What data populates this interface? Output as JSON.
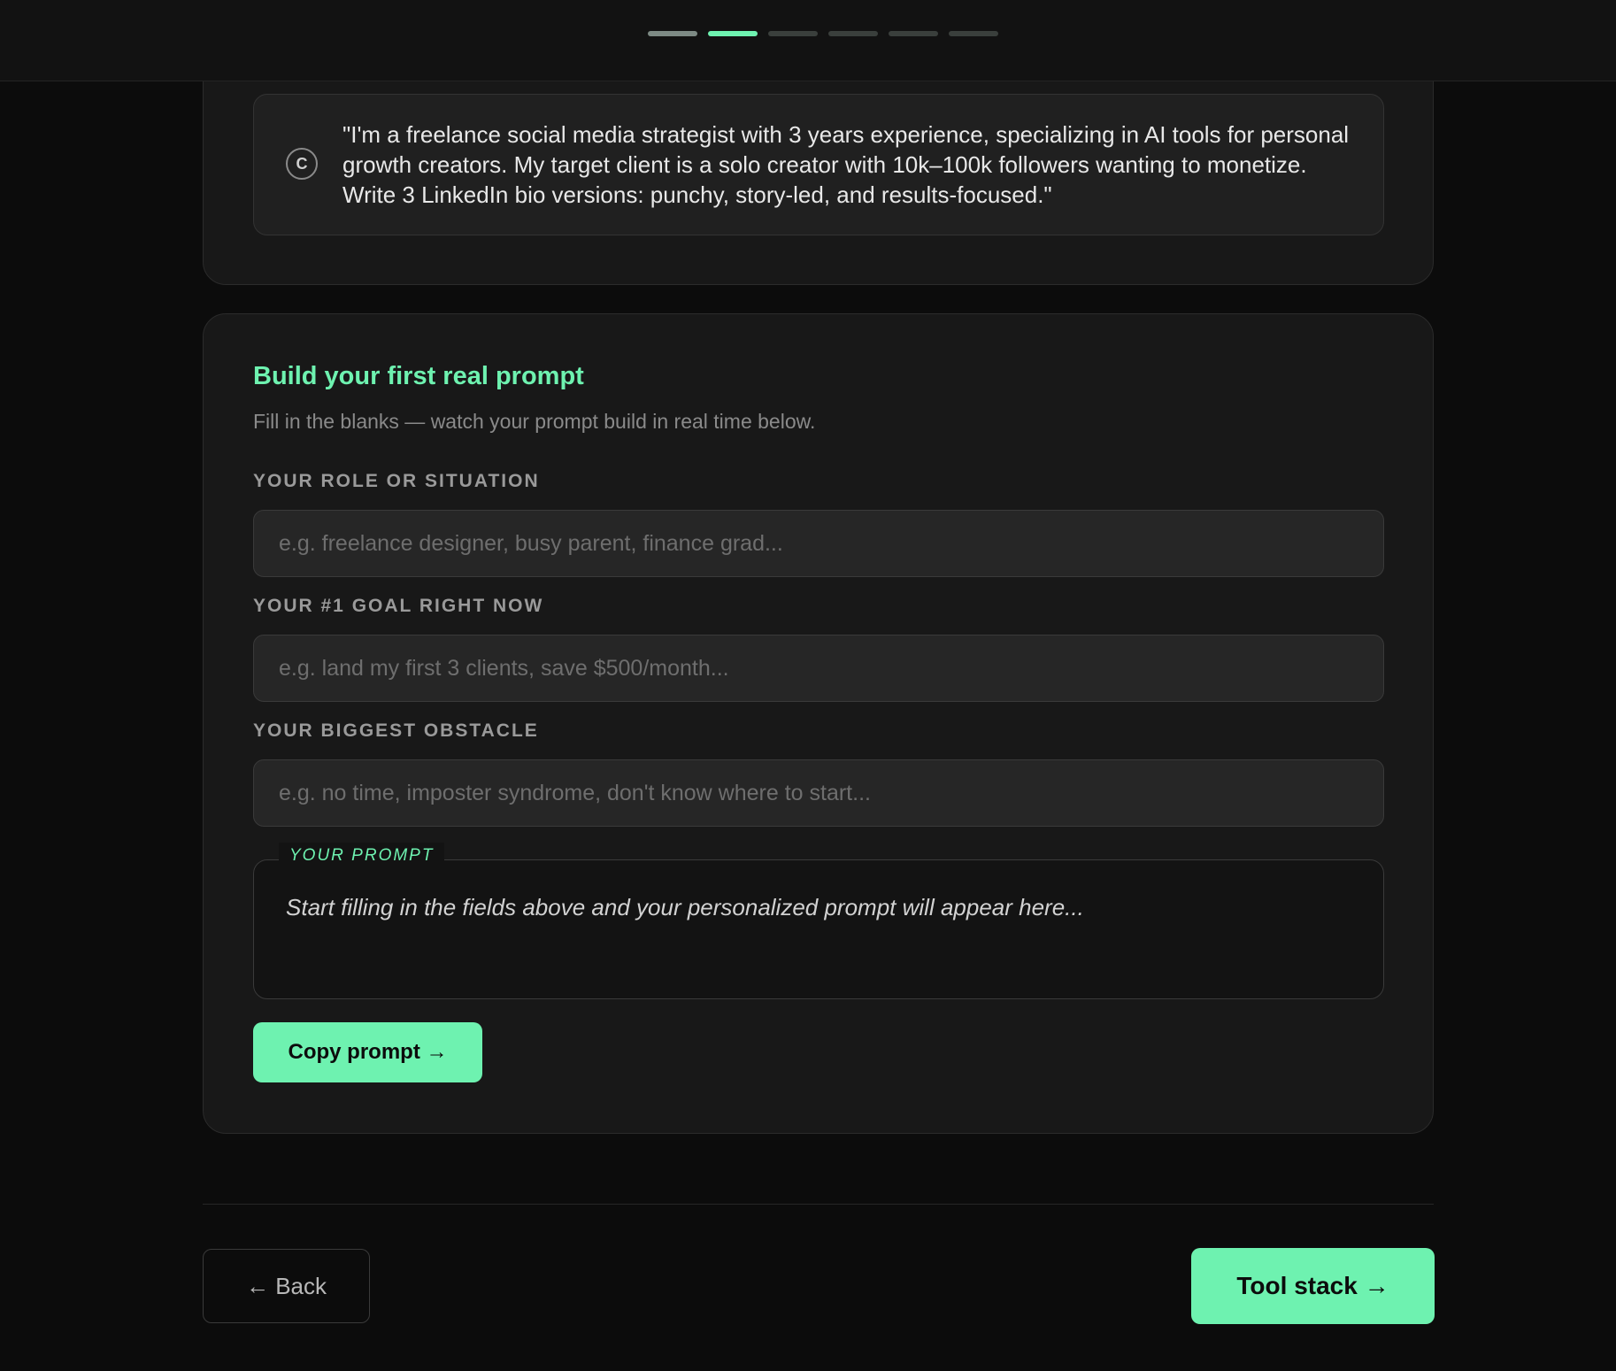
{
  "progress": {
    "total_steps": 6,
    "current_step": 2,
    "completed_steps": 1
  },
  "example": {
    "icon": "copyright-icon",
    "icon_glyph": "C",
    "text": "\"I'm a freelance social media strategist with 3 years experience, specializing in AI tools for personal growth creators. My target client is a solo creator with 10k–100k followers wanting to monetize. Write 3 LinkedIn bio versions: punchy, story-led, and results-focused.\""
  },
  "builder": {
    "title": "Build your first real prompt",
    "subtitle": "Fill in the blanks — watch your prompt build in real time below.",
    "fields": [
      {
        "label": "YOUR ROLE OR SITUATION",
        "value": "",
        "placeholder": "e.g. freelance designer, busy parent, finance grad..."
      },
      {
        "label": "YOUR #1 GOAL RIGHT NOW",
        "value": "",
        "placeholder": "e.g. land my first 3 clients, save $500/month..."
      },
      {
        "label": "YOUR BIGGEST OBSTACLE",
        "value": "",
        "placeholder": "e.g. no time, imposter syndrome, don't know where to start..."
      }
    ],
    "prompt_label": "YOUR PROMPT",
    "prompt_output": "Start filling in the fields above and your personalized prompt will appear here...",
    "copy_label": "Copy prompt →"
  },
  "nav": {
    "back_label": "← Back",
    "next_label": "Tool stack →"
  },
  "colors": {
    "accent": "#6ef2b0",
    "background": "#0c0c0c",
    "card": "#181818"
  }
}
